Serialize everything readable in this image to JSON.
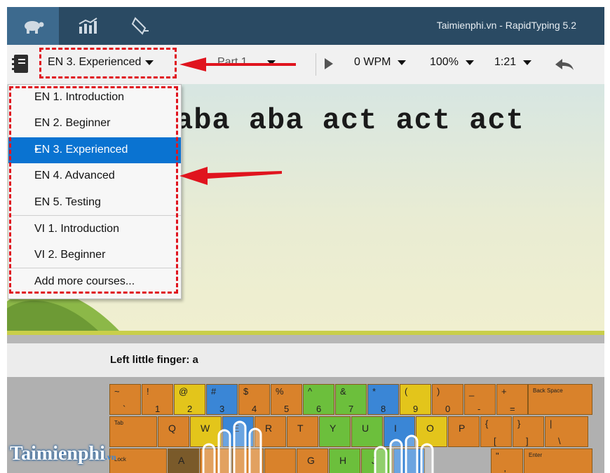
{
  "window": {
    "title": "Taimienphi.vn - RapidTyping 5.2"
  },
  "titlebar": {
    "buttons": [
      {
        "icon": "turtle-icon"
      },
      {
        "icon": "statistics-icon"
      },
      {
        "icon": "lesson-editor-icon"
      }
    ]
  },
  "toolbar": {
    "course": "EN 3. Experienced",
    "lesson": "Part 1",
    "wpm": "0 WPM",
    "zoom": "100%",
    "time": "1:21"
  },
  "course_menu": {
    "items": [
      {
        "label": "EN 1. Introduction",
        "selected": false
      },
      {
        "label": "EN 2. Beginner",
        "selected": false
      },
      {
        "label": "EN 3. Experienced",
        "selected": true
      },
      {
        "label": "EN 4. Advanced",
        "selected": false
      },
      {
        "label": "EN 5. Testing",
        "selected": false
      },
      {
        "label": "VI 1. Introduction",
        "selected": false
      },
      {
        "label": "VI 2. Beginner",
        "selected": false
      }
    ],
    "add_more": "Add more courses..."
  },
  "drill": {
    "text": "aba aba act act act"
  },
  "finger_hint": "Left little finger: a",
  "keyboard": {
    "number_row": [
      {
        "upper": "~",
        "lower": "`",
        "color": "#d9822b"
      },
      {
        "upper": "!",
        "lower": "1",
        "color": "#d9822b"
      },
      {
        "upper": "@",
        "lower": "2",
        "color": "#e3c51b"
      },
      {
        "upper": "#",
        "lower": "3",
        "color": "#3a86d6"
      },
      {
        "upper": "$",
        "lower": "4",
        "color": "#d9822b"
      },
      {
        "upper": "%",
        "lower": "5",
        "color": "#d9822b"
      },
      {
        "upper": "^",
        "lower": "6",
        "color": "#6cbf3c"
      },
      {
        "upper": "&",
        "lower": "7",
        "color": "#6cbf3c"
      },
      {
        "upper": "*",
        "lower": "8",
        "color": "#3a86d6"
      },
      {
        "upper": "(",
        "lower": "9",
        "color": "#e3c51b"
      },
      {
        "upper": ")",
        "lower": "0",
        "color": "#d9822b"
      },
      {
        "upper": "_",
        "lower": "-",
        "color": "#d9822b"
      },
      {
        "upper": "+",
        "lower": "=",
        "color": "#d9822b"
      }
    ],
    "backspace": "Back Space",
    "tab": "Tab",
    "qwerty_row": [
      {
        "label": "Q",
        "color": "#d9822b"
      },
      {
        "label": "W",
        "color": "#e3c51b"
      },
      {
        "label": "E",
        "color": "#3a86d6"
      },
      {
        "label": "R",
        "color": "#d9822b"
      },
      {
        "label": "T",
        "color": "#d9822b"
      },
      {
        "label": "Y",
        "color": "#6cbf3c"
      },
      {
        "label": "U",
        "color": "#6cbf3c"
      },
      {
        "label": "I",
        "color": "#3a86d6"
      },
      {
        "label": "O",
        "color": "#e3c51b"
      },
      {
        "label": "P",
        "color": "#d9822b"
      }
    ],
    "bracket_keys": [
      {
        "upper": "{",
        "lower": "["
      },
      {
        "upper": "}",
        "lower": "]"
      },
      {
        "upper": "|",
        "lower": "\\"
      }
    ],
    "home_row": [
      {
        "label": "A",
        "color": "#7a5a2a"
      },
      {
        "label": "",
        "color": "#d9822b"
      },
      {
        "label": "",
        "color": "#d9822b"
      },
      {
        "label": "",
        "color": "#d9822b"
      },
      {
        "label": "G",
        "color": "#d9822b"
      },
      {
        "label": "H",
        "color": "#6cbf3c"
      },
      {
        "label": "J",
        "color": "#6cbf3c"
      },
      {
        "label": "",
        "color": "#3a86d6"
      }
    ],
    "caps": "Lock",
    "quote_upper": "\"",
    "quote_lower": "'",
    "enter": "Enter"
  },
  "watermark": "Taimienphi",
  "watermark_suffix": ".vn"
}
